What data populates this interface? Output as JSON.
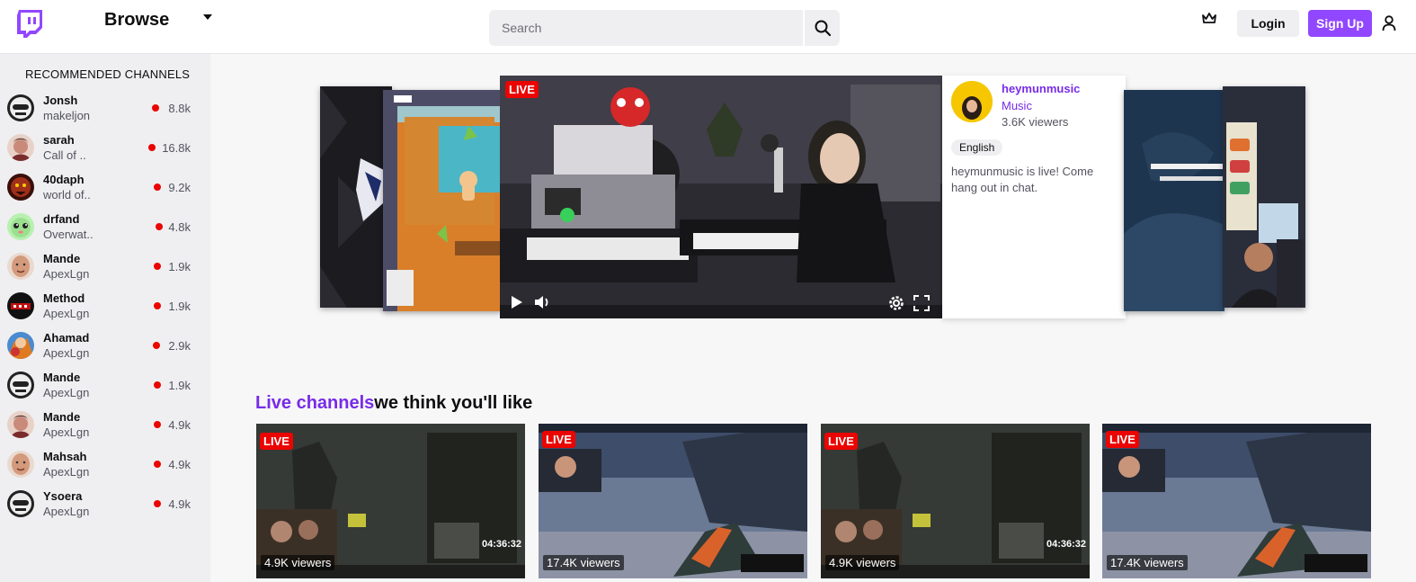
{
  "header": {
    "browse_label": "Browse",
    "search_placeholder": "Search",
    "login_label": "Login",
    "signup_label": "Sign Up",
    "brand_color": "#9147ff"
  },
  "sidebar": {
    "title": "RECOMMENDED CHANNELS",
    "channels": [
      {
        "name": "Jonsh",
        "game": "makeljon",
        "viewers": "8.8k"
      },
      {
        "name": "sarah",
        "game": "Call of ..",
        "viewers": "16.8k"
      },
      {
        "name": "40daph",
        "game": "world of..",
        "viewers": "9.2k"
      },
      {
        "name": "drfand",
        "game": "Overwat..",
        "viewers": "4.8k"
      },
      {
        "name": "Mande",
        "game": "ApexLgn",
        "viewers": "1.9k"
      },
      {
        "name": "Method",
        "game": "ApexLgn",
        "viewers": "1.9k"
      },
      {
        "name": "Ahamad",
        "game": "ApexLgn",
        "viewers": "2.9k"
      },
      {
        "name": "Mande",
        "game": "ApexLgn",
        "viewers": "1.9k"
      },
      {
        "name": "Mande",
        "game": "ApexLgn",
        "viewers": "4.9k"
      },
      {
        "name": "Mahsah",
        "game": "ApexLgn",
        "viewers": "4.9k"
      },
      {
        "name": "Ysoera",
        "game": "ApexLgn",
        "viewers": "4.9k"
      }
    ]
  },
  "featured": {
    "live_label": "LIVE",
    "channel": "heymunmusic",
    "game": "Music",
    "viewers": "3.6K viewers",
    "tag": "English",
    "description": "heymunmusic is live! Come hang out in chat."
  },
  "live_section": {
    "title_accent": "Live channels",
    "title_rest": "we think you'll like",
    "cards": [
      {
        "live": "LIVE",
        "viewers": "4.9K viewers",
        "time": "04:36:32"
      },
      {
        "live": "LIVE",
        "viewers": "17.4K viewers",
        "time": ""
      },
      {
        "live": "LIVE",
        "viewers": "4.9K viewers",
        "time": "04:36:32"
      },
      {
        "live": "LIVE",
        "viewers": "17.4K viewers",
        "time": ""
      }
    ]
  }
}
